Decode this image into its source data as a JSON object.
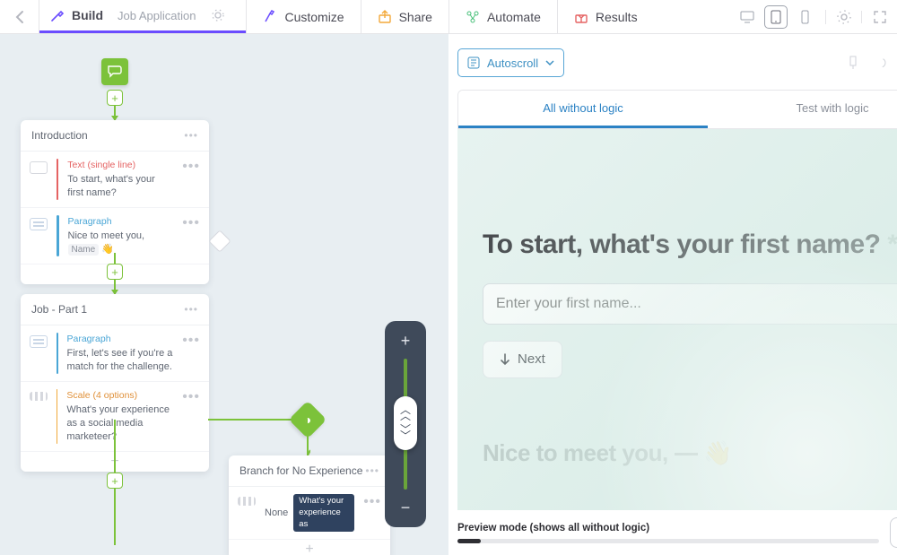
{
  "topbar": {
    "build_label": "Build",
    "doc_name": "Job Application",
    "tabs": {
      "customize": "Customize",
      "share": "Share",
      "automate": "Automate",
      "results": "Results"
    }
  },
  "canvas": {
    "card_intro": {
      "title": "Introduction",
      "rows": [
        {
          "type": "Text (single line)",
          "text": "To start, what's your first name?"
        },
        {
          "type": "Paragraph",
          "text_prefix": "Nice to meet you, ",
          "chip": "Name",
          "emoji": "👋"
        }
      ]
    },
    "card_job": {
      "title": "Job - Part 1",
      "rows": [
        {
          "type": "Paragraph",
          "text": "First, let's see if you're a match for the challenge."
        },
        {
          "type": "Scale (4 options)",
          "text": "What's your experience as a social media marketeer?"
        }
      ]
    },
    "card_branch": {
      "title": "Branch for No Experience",
      "row_label": "None",
      "row_pill": "What's your experience as"
    }
  },
  "preview": {
    "autoscroll": "Autoscroll",
    "tab_all": "All without logic",
    "tab_test": "Test with logic",
    "question": "To start, what's your first name?",
    "placeholder": "Enter your first name...",
    "next": "Next",
    "greeting_prefix": "Nice to meet you, ",
    "greeting_emoji": "👋",
    "footer_mode": "Preview mode (shows all without logic)"
  }
}
